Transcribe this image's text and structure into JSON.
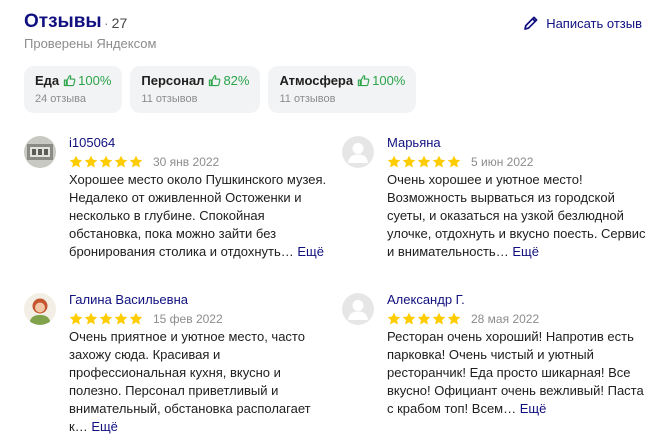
{
  "header": {
    "title": "Отзывы",
    "count": "27",
    "verified": "Проверены Яндексом",
    "write_label": "Написать отзыв"
  },
  "chips": [
    {
      "name": "Еда",
      "percent": "100%",
      "sub": "24 отзыва"
    },
    {
      "name": "Персонал",
      "percent": "82%",
      "sub": "11 отзывов"
    },
    {
      "name": "Атмосфера",
      "percent": "100%",
      "sub": "11 отзывов"
    }
  ],
  "reviews": [
    {
      "author": "i105064",
      "rating": 5,
      "date": "30 янв 2022",
      "text": "Хорошее место около Пушкинского музея. Недалеко от оживленной Остоженки и несколько в глубине. Спокойная обстановка, пока можно зайти без бронирования столика и отдохнуть…",
      "more": "Ещё",
      "avatar": "photo-avatar"
    },
    {
      "author": "Марьяна",
      "rating": 5,
      "date": "5 июн 2022",
      "text": "Очень хорошее и уютное место! Возможность вырваться из городской суеты, и оказаться на узкой безлюдной улочке, отдохнуть и вкусно поесть. Сервис и внимательность…",
      "more": "Ещё",
      "avatar": "default-avatar"
    },
    {
      "author": "Галина Васильевна",
      "rating": 5,
      "date": "15 фев 2022",
      "text": "Очень приятное и уютное место, часто захожу сюда. Красивая и профессиональная кухня, вкусно и полезно. Персонал приветливый и внимательный, обстановка располагает к…",
      "more": "Ещё",
      "avatar": "portrait-avatar"
    },
    {
      "author": "Александр Г.",
      "rating": 5,
      "date": "28 мая 2022",
      "text": "Ресторан очень хороший! Напротив есть парковка! Очень чистый и уютный ресторанчик! Еда просто шикарная! Все вкусно! Официант очень вежливый! Паста с крабом топ! Всем…",
      "more": "Ещё",
      "avatar": "default-avatar"
    }
  ],
  "colors": {
    "link": "#101080",
    "star": "#fc0",
    "positive": "#2ba44a",
    "chip_bg": "#f2f3f5",
    "muted": "#8c8c8c"
  }
}
